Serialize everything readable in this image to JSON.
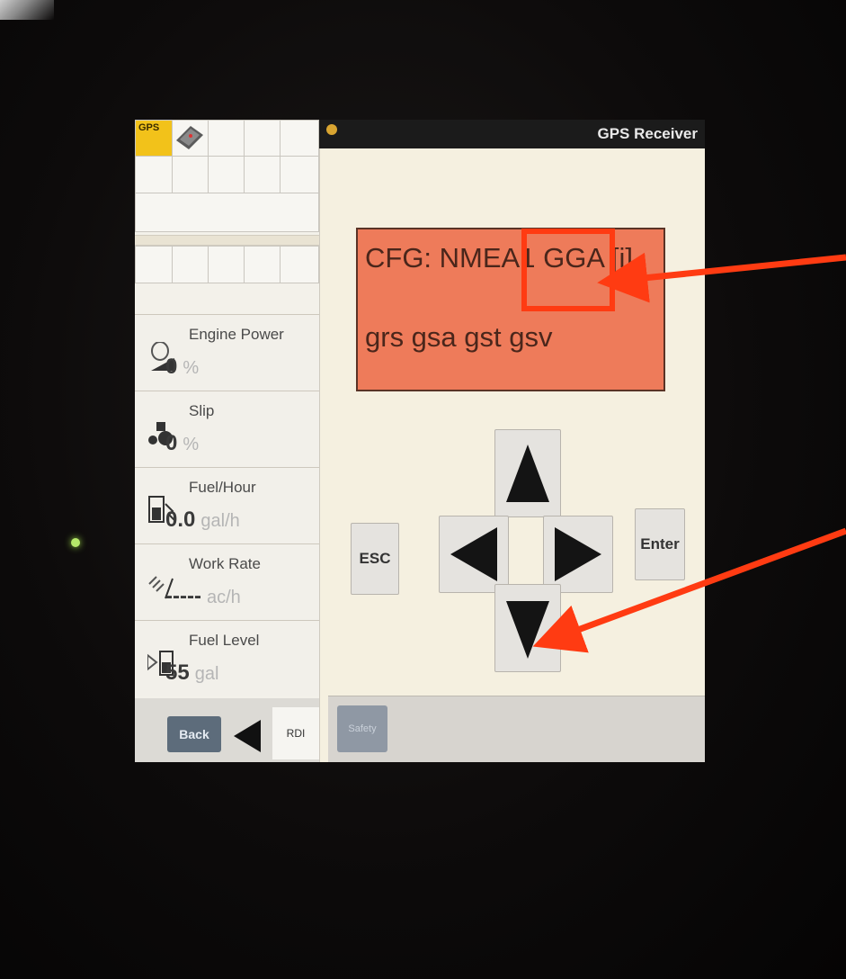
{
  "colors": {
    "accent_orange": "#ee7b5a",
    "annotation_red": "#ff3b12",
    "screen_bg": "#f5f0e0",
    "gps_tile": "#f2c21a"
  },
  "left_panel": {
    "gps_tile_label": "GPS",
    "metrics": [
      {
        "label": "Engine Power",
        "value": "0",
        "unit": "%",
        "icon": "engine-icon"
      },
      {
        "label": "Slip",
        "value": "0",
        "unit": "%",
        "icon": "tractor-slip-icon"
      },
      {
        "label": "Fuel/Hour",
        "value": "0.0",
        "unit": "gal/h",
        "icon": "fuel-pump-icon"
      },
      {
        "label": "Work Rate",
        "value": "-----",
        "unit": "ac/h",
        "icon": "work-rate-icon"
      },
      {
        "label": "Fuel Level",
        "value": "55",
        "unit": "gal",
        "icon": "fuel-level-icon"
      }
    ],
    "back_label": "Back",
    "rdi_label": "RDI"
  },
  "titlebar": {
    "title": "GPS Receiver"
  },
  "cfg_display": {
    "line1": "CFG: NMEA1 GGA [i]",
    "line2": "grs gsa gst gsv"
  },
  "controls": {
    "esc_label": "ESC",
    "enter_label": "Enter"
  },
  "bottom_bar": {
    "safety_label": "Safety"
  }
}
